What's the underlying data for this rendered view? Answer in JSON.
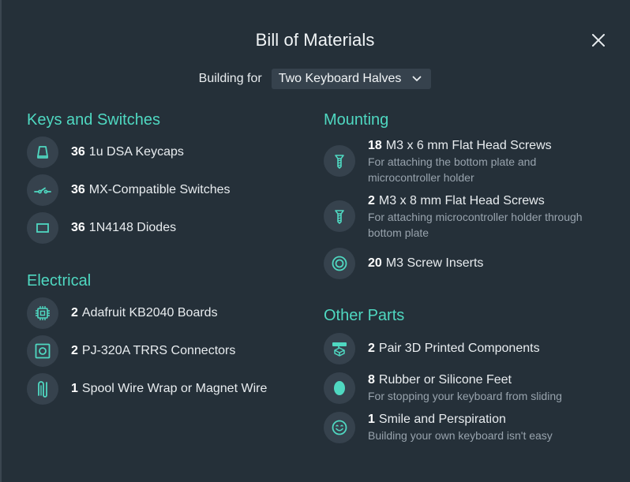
{
  "title": "Bill of Materials",
  "building_for": {
    "label": "Building for",
    "selected": "Two Keyboard Halves"
  },
  "sections": {
    "keys": {
      "title": "Keys and Switches",
      "items": [
        {
          "qty": "36",
          "name": "1u DSA Keycaps",
          "icon": "keycap-icon"
        },
        {
          "qty": "36",
          "name": "MX-Compatible Switches",
          "icon": "switch-icon"
        },
        {
          "qty": "36",
          "name": "1N4148 Diodes",
          "icon": "diode-icon"
        }
      ]
    },
    "electrical": {
      "title": "Electrical",
      "items": [
        {
          "qty": "2",
          "name": "Adafruit KB2040 Boards",
          "icon": "chip-icon"
        },
        {
          "qty": "2",
          "name": "PJ-320A TRRS Connectors",
          "icon": "connector-icon"
        },
        {
          "qty": "1",
          "name": "Spool Wire Wrap or Magnet Wire",
          "icon": "wire-icon"
        }
      ]
    },
    "mounting": {
      "title": "Mounting",
      "items": [
        {
          "qty": "18",
          "name": "M3 x 6 mm Flat Head Screws",
          "desc": "For attaching the bottom plate and microcontroller holder",
          "desc1": "For attaching the bottom plate and",
          "desc2": "microcontroller holder",
          "icon": "screw-icon"
        },
        {
          "qty": "2",
          "name": "M3 x 8 mm Flat Head Screws",
          "desc": "For attaching microcontroller holder through bottom plate",
          "desc1": "For attaching microcontroller holder through",
          "desc2": "bottom plate",
          "icon": "screw-icon"
        },
        {
          "qty": "20",
          "name": "M3 Screw Inserts",
          "icon": "insert-icon"
        }
      ]
    },
    "other": {
      "title": "Other Parts",
      "items": [
        {
          "qty": "2",
          "name": "Pair 3D Printed Components",
          "icon": "printer-icon"
        },
        {
          "qty": "8",
          "name": "Rubber or Silicone Feet",
          "desc": "For stopping your keyboard from sliding",
          "icon": "foot-icon"
        },
        {
          "qty": "1",
          "name": "Smile and Perspiration",
          "desc": "Building your own keyboard isn't easy",
          "icon": "smile-icon"
        }
      ]
    }
  },
  "colors": {
    "accent": "#4fd8c1",
    "background": "#253039",
    "icon_bg": "#36424d",
    "muted_text": "#98a3ad"
  }
}
